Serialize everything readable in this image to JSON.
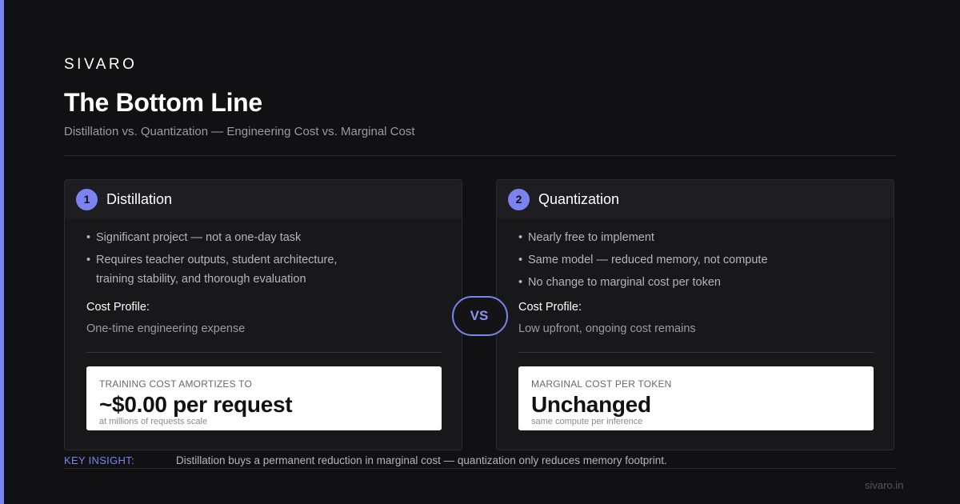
{
  "brand": "SIVARO",
  "title": "The Bottom Line",
  "subtitle": "Distillation vs. Quantization — Engineering Cost vs. Marginal Cost",
  "colors": {
    "accent": "#7b83f0",
    "background": "#111113",
    "card": "#18181b"
  },
  "cards": [
    {
      "number": "1",
      "title": "Distillation",
      "bullets": [
        "Significant project — not a one-day task",
        "Requires teacher outputs, student architecture, training stability, and thorough evaluation"
      ],
      "bullet_lines": [
        [
          "Significant project — not a one-day task"
        ],
        [
          "Requires teacher outputs, student architecture,",
          "training stability, and thorough evaluation"
        ]
      ],
      "cost_label": "Cost Profile:",
      "cost_value": "One-time engineering expense",
      "metric_caption": "TRAINING COST AMORTIZES TO",
      "metric_value": "~$0.00 per request",
      "metric_note": "at millions of requests scale"
    },
    {
      "number": "2",
      "title": "Quantization",
      "bullets": [
        "Nearly free to implement",
        "Same model — reduced memory, not compute",
        "No change to marginal cost per token"
      ],
      "cost_label": "Cost Profile:",
      "cost_value": "Low upfront, ongoing cost remains",
      "metric_caption": "MARGINAL COST PER TOKEN",
      "metric_value": "Unchanged",
      "metric_note": "same compute per inference"
    }
  ],
  "vs_label": "VS",
  "insight": {
    "label": "KEY INSIGHT:",
    "text": "Distillation buys a permanent reduction in marginal cost — quantization only reduces memory footprint."
  },
  "footer_url": "sivaro.in"
}
